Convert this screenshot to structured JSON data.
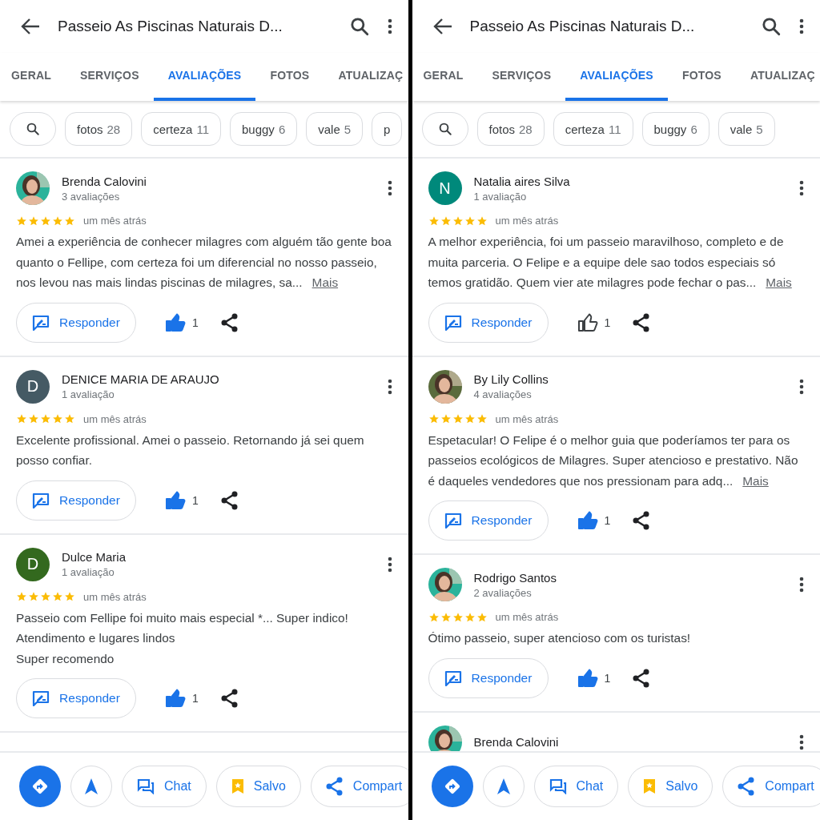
{
  "panels": [
    {
      "header": {
        "title": "Passeio As Piscinas Naturais D..."
      },
      "tabs": [
        {
          "label": "GERAL",
          "selected": false
        },
        {
          "label": "SERVIÇOS",
          "selected": false
        },
        {
          "label": "AVALIAÇÕES",
          "selected": true
        },
        {
          "label": "FOTOS",
          "selected": false
        },
        {
          "label": "ATUALIZAÇ",
          "selected": false
        }
      ],
      "chips": [
        {
          "label": "fotos",
          "count": "28"
        },
        {
          "label": "certeza",
          "count": "11"
        },
        {
          "label": "buggy",
          "count": "6"
        },
        {
          "label": "vale",
          "count": "5"
        },
        {
          "label": "p"
        }
      ],
      "reviews": [
        {
          "name": "Brenda Calovini",
          "reviews_count": "3 avaliações",
          "stars": 5,
          "time": "um mês atrás",
          "text": "Amei a experiência de conhecer milagres com alguém tão gente boa quanto o Fellipe, com certeza foi um diferencial no nosso passeio, nos levou nas mais lindas piscinas de milagres, sa...",
          "more": "Mais",
          "reply": "Responder",
          "likes": "1",
          "liked": true
        },
        {
          "name": "DENICE MARIA DE ARAUJO",
          "reviews_count": "1 avaliação",
          "avatar": {
            "kind": "letter",
            "letter": "D",
            "color": "#455a64"
          },
          "stars": 5,
          "time": "um mês atrás",
          "text": "Excelente profissional. Amei o passeio. Retornando já sei quem posso confiar.",
          "reply": "Responder",
          "likes": "1",
          "liked": true
        },
        {
          "name": "Dulce Maria",
          "reviews_count": "1 avaliação",
          "avatar": {
            "kind": "letter",
            "letter": "D",
            "color": "#33691e"
          },
          "stars": 5,
          "time": "um mês atrás",
          "text": "Passeio com  Fellipe foi muito mais especial *... Super indico!\nAtendimento e lugares lindos\nSuper recomendo",
          "reply": "Responder",
          "likes": "1",
          "liked": true
        }
      ],
      "actions": [
        {
          "kind": "directions"
        },
        {
          "kind": "navigate"
        },
        {
          "kind": "chat",
          "label": "Chat"
        },
        {
          "kind": "saved",
          "label": "Salvo"
        },
        {
          "kind": "share",
          "label": "Compart"
        }
      ]
    },
    {
      "header": {
        "title": "Passeio As Piscinas Naturais D..."
      },
      "tabs": [
        {
          "label": "GERAL",
          "selected": false
        },
        {
          "label": "SERVIÇOS",
          "selected": false
        },
        {
          "label": "AVALIAÇÕES",
          "selected": true
        },
        {
          "label": "FOTOS",
          "selected": false
        },
        {
          "label": "ATUALIZAÇ",
          "selected": false
        }
      ],
      "chips": [
        {
          "label": "fotos",
          "count": "28"
        },
        {
          "label": "certeza",
          "count": "11"
        },
        {
          "label": "buggy",
          "count": "6"
        },
        {
          "label": "vale",
          "count": "5"
        }
      ],
      "reviews": [
        {
          "name": "Natalia aires Silva",
          "reviews_count": "1 avaliação",
          "avatar": {
            "kind": "letter",
            "letter": "N",
            "color": "#00897b"
          },
          "stars": 5,
          "time": "um mês atrás",
          "text": "A melhor experiência, foi um passeio maravilhoso, completo e de muita parceria. O Felipe e a equipe dele sao todos especiais só temos gratidão. Quem vier ate milagres pode fechar o pas...",
          "more": "Mais",
          "reply": "Responder",
          "likes": "1",
          "liked": false
        },
        {
          "name": "By Lily Collins",
          "reviews_count": "4 avaliações",
          "stars": 5,
          "time": "um mês atrás",
          "text": "Espetacular! O Felipe é o melhor guia que poderíamos ter para os passeios ecológicos de Milagres. Super atencioso e prestativo. Não é daqueles vendedores que nos pressionam para adq...",
          "more": "Mais",
          "reply": "Responder",
          "likes": "1",
          "liked": true
        },
        {
          "name": "Rodrigo Santos",
          "reviews_count": "2 avaliações",
          "stars": 5,
          "time": "um mês atrás",
          "text": "Ótimo passeio, super atencioso com os turistas!",
          "reply": "Responder",
          "likes": "1",
          "liked": true
        }
      ],
      "partial_review": {
        "name": "Brenda Calovini"
      },
      "actions": [
        {
          "kind": "directions"
        },
        {
          "kind": "navigate"
        },
        {
          "kind": "chat",
          "label": "Chat"
        },
        {
          "kind": "saved",
          "label": "Salvo"
        },
        {
          "kind": "share",
          "label": "Compart"
        }
      ]
    }
  ]
}
